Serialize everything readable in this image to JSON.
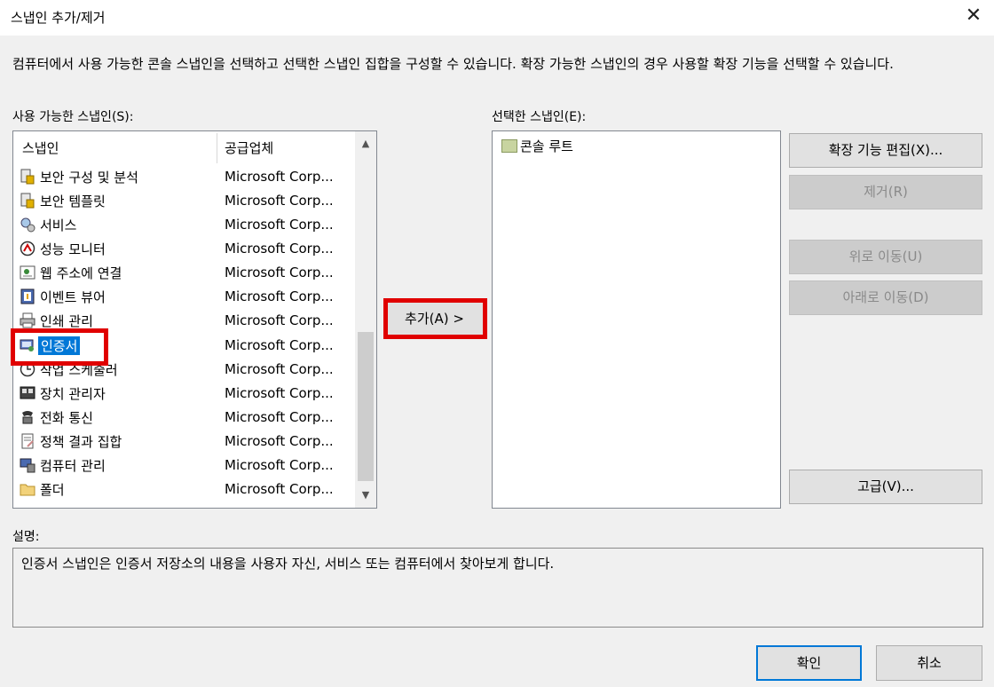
{
  "window": {
    "title": "스냅인 추가/제거",
    "close_glyph": "✕"
  },
  "description_top": "컴퓨터에서 사용 가능한 콘솔 스냅인을 선택하고 선택한 스냅인 집합을 구성할 수 있습니다. 확장 가능한 스냅인의 경우 사용할 확장 기능을 선택할 수 있습니다.",
  "available": {
    "label": "사용 가능한 스냅인(S):",
    "columns": [
      "스냅인",
      "공급업체"
    ],
    "rows": [
      {
        "name": "보안 구성 및 분석",
        "vendor": "Microsoft Corp...",
        "icon": "security-config-icon"
      },
      {
        "name": "보안 템플릿",
        "vendor": "Microsoft Corp...",
        "icon": "security-template-icon"
      },
      {
        "name": "서비스",
        "vendor": "Microsoft Corp...",
        "icon": "services-gear-icon"
      },
      {
        "name": "성능 모니터",
        "vendor": "Microsoft Corp...",
        "icon": "performance-monitor-icon"
      },
      {
        "name": "웹 주소에 연결",
        "vendor": "Microsoft Corp...",
        "icon": "web-link-icon"
      },
      {
        "name": "이벤트 뷰어",
        "vendor": "Microsoft Corp...",
        "icon": "event-viewer-icon"
      },
      {
        "name": "인쇄 관리",
        "vendor": "Microsoft Corp...",
        "icon": "print-management-icon"
      },
      {
        "name": "인증서",
        "vendor": "Microsoft Corp...",
        "icon": "certificates-icon",
        "selected": true
      },
      {
        "name": "작업 스케줄러",
        "vendor": "Microsoft Corp...",
        "icon": "task-scheduler-icon"
      },
      {
        "name": "장치 관리자",
        "vendor": "Microsoft Corp...",
        "icon": "device-manager-icon"
      },
      {
        "name": "전화 통신",
        "vendor": "Microsoft Corp...",
        "icon": "telephony-icon"
      },
      {
        "name": "정책 결과 집합",
        "vendor": "Microsoft Corp...",
        "icon": "policy-result-icon"
      },
      {
        "name": "컴퓨터 관리",
        "vendor": "Microsoft Corp...",
        "icon": "computer-management-icon"
      },
      {
        "name": "폴더",
        "vendor": "Microsoft Corp...",
        "icon": "folder-icon"
      }
    ]
  },
  "add_button": "추가(A) >",
  "selected": {
    "label": "선택한 스냅인(E):",
    "root_item": "콘솔 루트"
  },
  "side_buttons": {
    "edit_extensions": "확장 기능 편집(X)...",
    "remove": "제거(R)",
    "move_up": "위로 이동(U)",
    "move_down": "아래로 이동(D)",
    "advanced": "고급(V)..."
  },
  "description": {
    "label": "설명:",
    "text": "인증서 스냅인은 인증서 저장소의 내용을 사용자 자신, 서비스 또는 컴퓨터에서 찾아보게 합니다."
  },
  "footer": {
    "ok": "확인",
    "cancel": "취소"
  },
  "colors": {
    "highlight": "#0078d7",
    "annotation_red": "#e00000"
  }
}
